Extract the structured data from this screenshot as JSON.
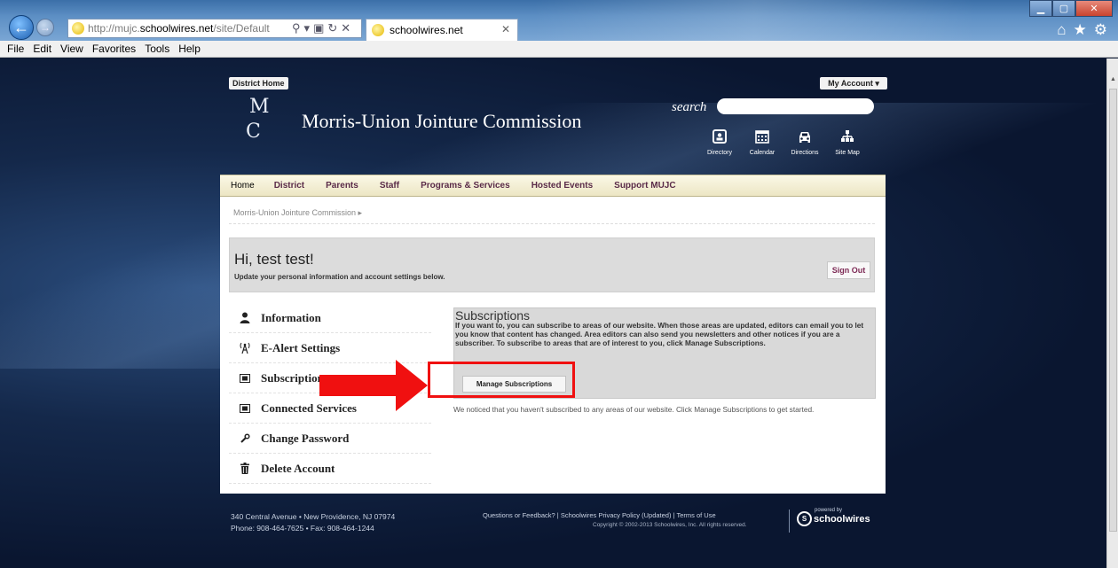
{
  "browser": {
    "address_prefix": "http://mujc.",
    "address_domain": "schoolwires.net",
    "address_suffix": "/site/Default",
    "tab_title": "schoolwires.net",
    "tab_close": "✕",
    "menu": [
      "File",
      "Edit",
      "View",
      "Favorites",
      "Tools",
      "Help"
    ]
  },
  "site": {
    "district_home": "District Home",
    "my_account": "My Account ▾",
    "title": "Morris-Union Jointure Commission",
    "search_label": "search",
    "quick_links": [
      {
        "label": "Directory",
        "icon": "directory-icon"
      },
      {
        "label": "Calendar",
        "icon": "calendar-icon"
      },
      {
        "label": "Directions",
        "icon": "car-icon"
      },
      {
        "label": "Site Map",
        "icon": "sitemap-icon"
      }
    ],
    "nav": [
      "Home",
      "District",
      "Parents",
      "Staff",
      "Programs & Services",
      "Hosted Events",
      "Support MUJC"
    ],
    "breadcrumb": "Morris-Union Jointure Commission ▸"
  },
  "account": {
    "greeting": "Hi, test test!",
    "subtitle": "Update your personal information and account settings below.",
    "sign_out": "Sign Out",
    "menu": [
      {
        "label": "Information",
        "icon": "person-icon"
      },
      {
        "label": "E-Alert Settings",
        "icon": "antenna-icon"
      },
      {
        "label": "Subscriptions",
        "icon": "subscriptions-icon"
      },
      {
        "label": "Connected Services",
        "icon": "connected-services-icon"
      },
      {
        "label": "Change Password",
        "icon": "wrench-icon"
      },
      {
        "label": "Delete Account",
        "icon": "trash-icon"
      }
    ]
  },
  "subscriptions": {
    "title": "Subscriptions",
    "description": "If you want to, you can subscribe to areas of our website. When those areas are updated, editors can email you to let you know that content has changed. Area editors can also send you newsletters and other notices if you are a subscriber. To subscribe to areas that are of interest to you, click Manage Subscriptions.",
    "manage_button": "Manage Subscriptions",
    "notice": "We noticed that you haven't subscribed to any areas of our website. Click Manage Subscriptions to get started."
  },
  "footer": {
    "address_line1": "340 Central Avenue • New Providence, NJ 07974",
    "address_line2": "Phone: 908-464-7625 • Fax: 908-464-1244",
    "links": "Questions or Feedback?   |   Schoolwires Privacy Policy (Updated)   |   Terms of Use",
    "copyright": "Copyright © 2002-2013 Schoolwires, Inc. All rights reserved.",
    "powered_by": "powered by",
    "brand": "schoolwires"
  },
  "colors": {
    "accent_red": "#f01010",
    "nav_text": "#5a2b48",
    "page_bg": "#0a1630"
  }
}
